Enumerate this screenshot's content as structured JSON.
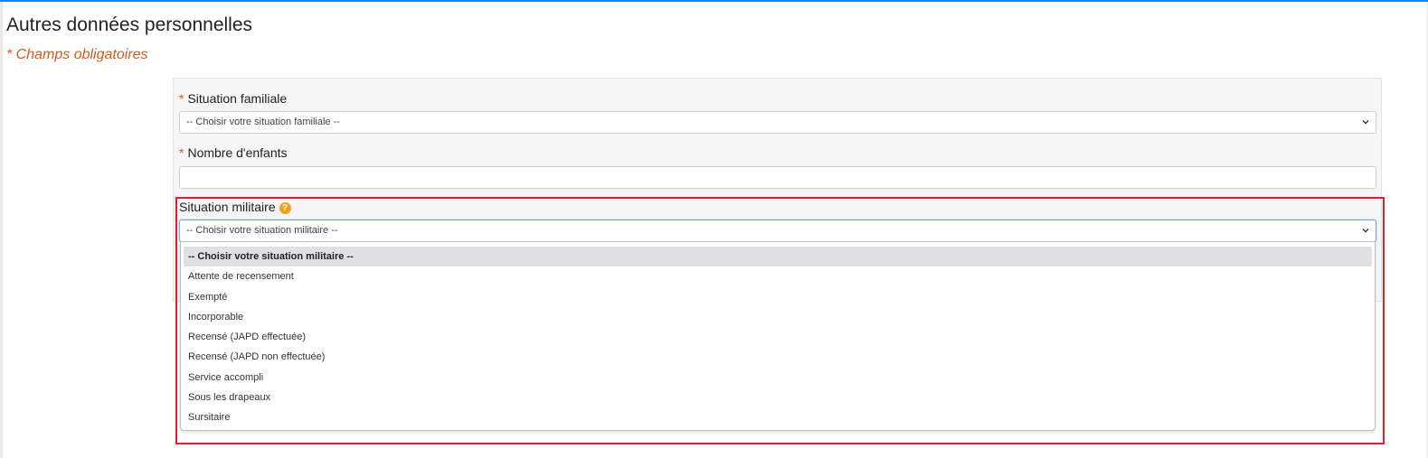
{
  "page": {
    "title": "Autres données personnelles",
    "required_note": "* Champs obligatoires"
  },
  "form": {
    "family_status": {
      "star": "*",
      "label": "Situation familiale",
      "selected": "-- Choisir votre situation familiale --"
    },
    "children": {
      "star": "*",
      "label": "Nombre d'enfants",
      "value": ""
    },
    "military": {
      "label": "Situation militaire",
      "help_icon_glyph": "?",
      "selected": "-- Choisir votre situation militaire --",
      "options": [
        "-- Choisir votre situation militaire --",
        "Attente de recensement",
        "Exempté",
        "Incorporable",
        "Recensé (JAPD effectuée)",
        "Recensé (JAPD non effectuée)",
        "Service accompli",
        "Sous les drapeaux",
        "Sursitaire"
      ],
      "highlighted_option_index": 0
    }
  },
  "colors": {
    "accent_top_bar": "#0a84ff",
    "required": "#d05a1f",
    "help_icon": "#f0a020",
    "highlight_outline": "#e0202a"
  },
  "icons": {
    "select_arrow": "chevron-down-icon",
    "help": "question-circle-icon"
  }
}
